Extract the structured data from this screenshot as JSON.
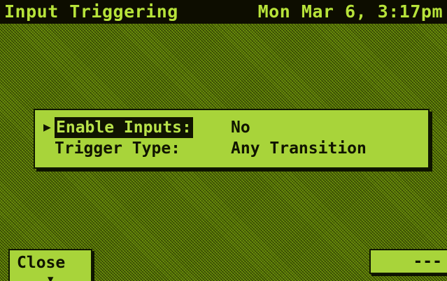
{
  "header": {
    "title": "Input Triggering",
    "datetime": "Mon Mar 6, 3:17pm"
  },
  "settings": {
    "rows": [
      {
        "label": "Enable Inputs:",
        "value": "No",
        "selected": true
      },
      {
        "label": "Trigger Type:",
        "value": "Any Transition",
        "selected": false
      }
    ],
    "cursor_glyph": "▶"
  },
  "softkeys": {
    "left_label": "Close",
    "left_arrow": "▼",
    "right_label": "---"
  },
  "colors": {
    "lcd_background": "#5a7a06",
    "panel": "#a8d43a",
    "ink": "#101400",
    "title_text": "#b7e33a"
  }
}
